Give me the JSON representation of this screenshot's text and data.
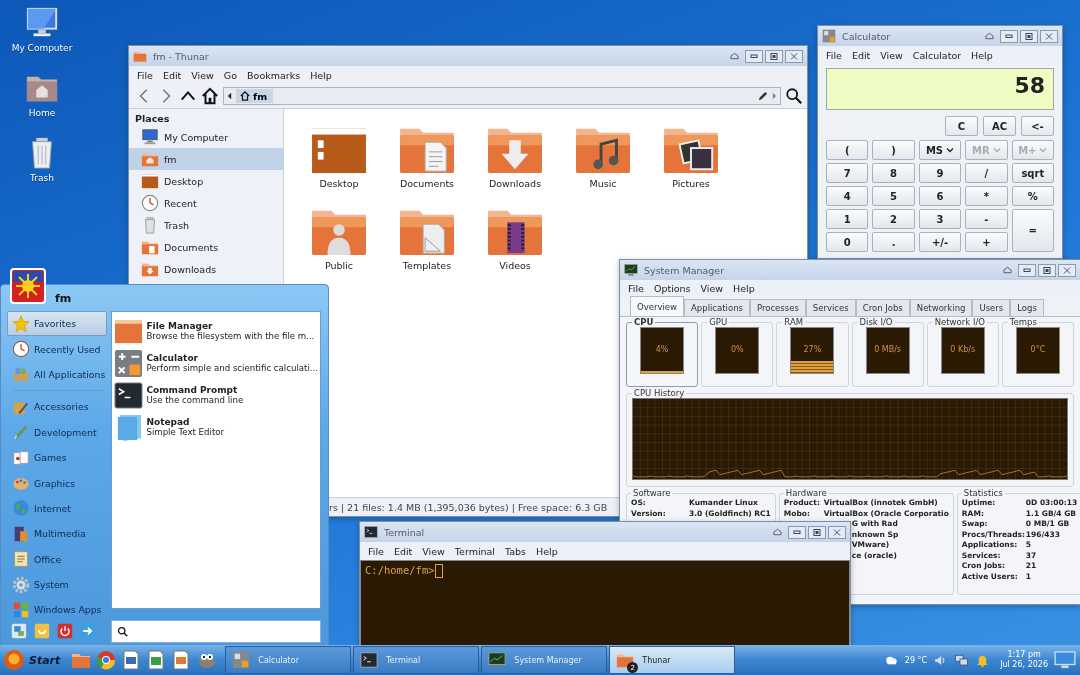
{
  "desktop_icons": [
    {
      "label": "My Computer",
      "kind": "computer"
    },
    {
      "label": "Home",
      "kind": "home"
    },
    {
      "label": "Trash",
      "kind": "trash"
    }
  ],
  "thunar": {
    "title": "fm - Thunar",
    "menu": [
      "File",
      "Edit",
      "View",
      "Go",
      "Bookmarks",
      "Help"
    ],
    "path": "fm",
    "places_heading": "Places",
    "places": [
      {
        "label": "My Computer",
        "kind": "computer",
        "selected": false
      },
      {
        "label": "fm",
        "kind": "home",
        "selected": true
      },
      {
        "label": "Desktop",
        "kind": "desktop",
        "selected": false
      },
      {
        "label": "Recent",
        "kind": "recent",
        "selected": false
      },
      {
        "label": "Trash",
        "kind": "trash",
        "selected": false
      },
      {
        "label": "Documents",
        "kind": "documents",
        "selected": false
      },
      {
        "label": "Downloads",
        "kind": "downloads",
        "selected": false
      }
    ],
    "files": [
      {
        "name": "Desktop",
        "kind": "desktop"
      },
      {
        "name": "Documents",
        "kind": "documents"
      },
      {
        "name": "Downloads",
        "kind": "downloads"
      },
      {
        "name": "Music",
        "kind": "music"
      },
      {
        "name": "Pictures",
        "kind": "pictures"
      },
      {
        "name": "Public",
        "kind": "public"
      },
      {
        "name": "Templates",
        "kind": "templates"
      },
      {
        "name": "Videos",
        "kind": "videos"
      }
    ],
    "status": "rs | 21 files: 1.4 MB (1,395,036 bytes) | Free space: 6.3 GB"
  },
  "calculator": {
    "title": "Calculator",
    "menu": [
      "File",
      "Edit",
      "View",
      "Calculator",
      "Help"
    ],
    "display": "58",
    "top_keys": [
      "C",
      "AC",
      "<-"
    ],
    "keys": [
      {
        "label": "(",
        "kind": "key",
        "disabled": false
      },
      {
        "label": ")",
        "kind": "key",
        "disabled": false
      },
      {
        "label": "MS",
        "kind": "memory",
        "disabled": false
      },
      {
        "label": "MR",
        "kind": "memory",
        "disabled": true
      },
      {
        "label": "M+",
        "kind": "memory",
        "disabled": true
      },
      {
        "label": "7",
        "kind": "key",
        "disabled": false
      },
      {
        "label": "8",
        "kind": "key",
        "disabled": false
      },
      {
        "label": "9",
        "kind": "key",
        "disabled": false
      },
      {
        "label": "/",
        "kind": "key",
        "disabled": false
      },
      {
        "label": "sqrt",
        "kind": "key",
        "disabled": false
      },
      {
        "label": "4",
        "kind": "key",
        "disabled": false
      },
      {
        "label": "5",
        "kind": "key",
        "disabled": false
      },
      {
        "label": "6",
        "kind": "key",
        "disabled": false
      },
      {
        "label": "*",
        "kind": "key",
        "disabled": false
      },
      {
        "label": "%",
        "kind": "key",
        "disabled": false
      },
      {
        "label": "1",
        "kind": "key",
        "disabled": false
      },
      {
        "label": "2",
        "kind": "key",
        "disabled": false
      },
      {
        "label": "3",
        "kind": "key",
        "disabled": false
      },
      {
        "label": "-",
        "kind": "key",
        "disabled": false
      },
      {
        "label": "=",
        "kind": "equals",
        "disabled": false
      },
      {
        "label": "0",
        "kind": "key",
        "disabled": false
      },
      {
        "label": ".",
        "kind": "key",
        "disabled": false
      },
      {
        "label": "+/-",
        "kind": "key",
        "disabled": false
      },
      {
        "label": "+",
        "kind": "key",
        "disabled": false
      }
    ]
  },
  "system_manager": {
    "title": "System Manager",
    "menu": [
      "File",
      "Options",
      "View",
      "Help"
    ],
    "tabs": [
      {
        "label": "Overview",
        "selected": true
      },
      {
        "label": "Applications",
        "selected": false
      },
      {
        "label": "Processes",
        "selected": false
      },
      {
        "label": "Services",
        "selected": false
      },
      {
        "label": "Cron Jobs",
        "selected": false
      },
      {
        "label": "Networking",
        "selected": false
      },
      {
        "label": "Users",
        "selected": false
      },
      {
        "label": "Logs",
        "selected": false
      }
    ],
    "meters": [
      {
        "label": "CPU",
        "reading": "4%",
        "level": 0.04,
        "focused": true
      },
      {
        "label": "GPU",
        "reading": "0%",
        "focused": false
      },
      {
        "label": "RAM",
        "reading": "27%",
        "level": 0.27,
        "focused": false
      },
      {
        "label": "Disk I/O",
        "reading": "0 MB/s",
        "focused": false
      },
      {
        "label": "Network I/O",
        "reading": "0 Kb/s",
        "focused": false
      },
      {
        "label": "Temps",
        "reading": "0°C",
        "focused": false
      }
    ],
    "history_title": "CPU History",
    "software": {
      "title": "Software",
      "rows": [
        {
          "label": "OS:",
          "value": "Kumander Linux"
        },
        {
          "label": "Version:",
          "value": "3.0 (Goldfinch) RC1"
        }
      ]
    },
    "hardware": {
      "title": "Hardware",
      "rows": [
        {
          "label": "Product:",
          "value": "VirtualBox (innotek GmbH)"
        },
        {
          "label": "Mobo:",
          "value": "VirtualBox (Oracle Corporatio"
        },
        {
          "value": "G with Rad"
        },
        {
          "value": "nknown Sp"
        },
        {
          "value": "VMware)"
        },
        {
          "value": "ce (oracle)"
        }
      ]
    },
    "statistics": {
      "title": "Statistics",
      "rows": [
        {
          "label": "Uptime:",
          "value": "0D 03:00:13"
        },
        {
          "label": "RAM:",
          "value": "1.1 GB/4 GB"
        },
        {
          "label": "Swap:",
          "value": "0 MB/1 GB"
        },
        {
          "label": "Procs/Threads:",
          "value": "196/433"
        },
        {
          "label": "Applications:",
          "value": "5"
        },
        {
          "label": "Services:",
          "value": "37"
        },
        {
          "label": "Cron Jobs:",
          "value": "21"
        },
        {
          "label": "Active Users:",
          "value": "1"
        }
      ]
    }
  },
  "terminal": {
    "title": "Terminal",
    "menu": [
      "File",
      "Edit",
      "View",
      "Terminal",
      "Tabs",
      "Help"
    ],
    "prompt": "C:/home/fm>"
  },
  "start_menu": {
    "user": "fm",
    "quick": [
      {
        "label": "Favorites",
        "kind": "favorites",
        "selected": true
      },
      {
        "label": "Recently Used",
        "kind": "recent",
        "selected": false
      },
      {
        "label": "All Applications",
        "kind": "all",
        "selected": false
      }
    ],
    "categories": [
      {
        "label": "Accessories",
        "kind": "accessories",
        "selected": false
      },
      {
        "label": "Development",
        "kind": "development",
        "selected": false
      },
      {
        "label": "Games",
        "kind": "games",
        "selected": false
      },
      {
        "label": "Graphics",
        "kind": "graphics",
        "selected": false
      },
      {
        "label": "Internet",
        "kind": "internet",
        "selected": false
      },
      {
        "label": "Multimedia",
        "kind": "multimedia",
        "selected": false
      },
      {
        "label": "Office",
        "kind": "office",
        "selected": false
      },
      {
        "label": "System",
        "kind": "system",
        "selected": false
      },
      {
        "label": "Windows Apps",
        "kind": "windows",
        "selected": false
      }
    ],
    "apps": [
      {
        "name": "File Manager",
        "description": "Browse the filesystem with the file m...",
        "kind": "file_manager"
      },
      {
        "name": "Calculator",
        "description": "Perform simple and scientific calculati...",
        "kind": "calculator"
      },
      {
        "name": "Command Prompt",
        "description": "Use the command line",
        "kind": "terminal"
      },
      {
        "name": "Notepad",
        "description": "Simple Text Editor",
        "kind": "notepad"
      }
    ]
  },
  "taskbar": {
    "start": "Start",
    "tasks": [
      {
        "label": "Calculator",
        "kind": "calculator",
        "selected": false
      },
      {
        "label": "Terminal",
        "kind": "terminal",
        "selected": false
      },
      {
        "label": "System Manager",
        "kind": "monitor",
        "selected": false
      },
      {
        "label": "Thunar",
        "kind": "folder",
        "selected": true,
        "count": "2"
      }
    ],
    "weather": "29 °C",
    "time": "1:17 pm",
    "date": "Jul 26, 2026"
  }
}
